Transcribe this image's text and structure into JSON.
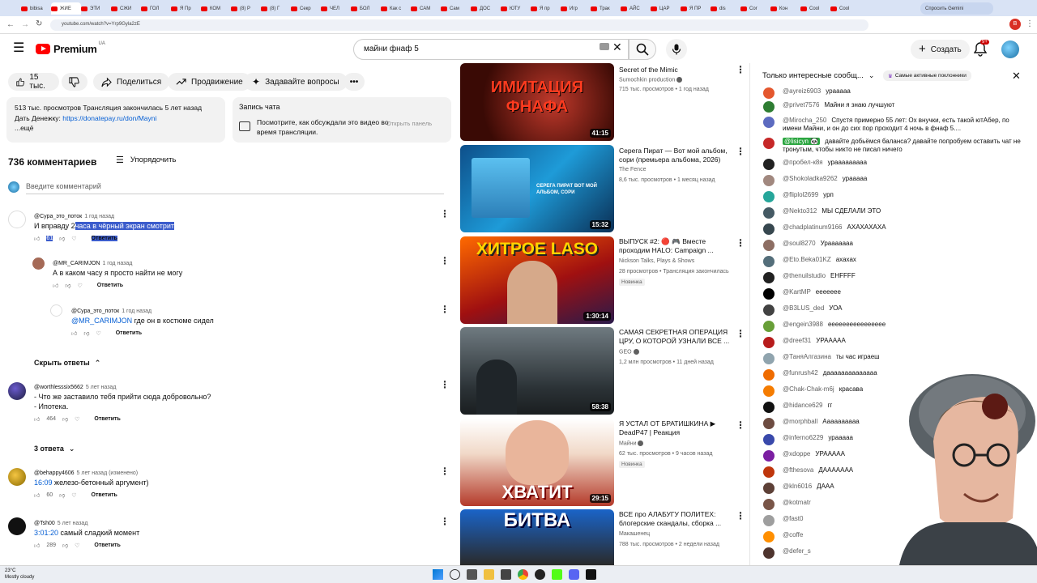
{
  "browser": {
    "tabs": [
      "bibisa",
      "ЖИЕ",
      "ЭТИ",
      "СЖИ",
      "ГОЛ",
      "Я Пр",
      "КОМ",
      "(8) Р",
      "(8) Г",
      "Секр",
      "ЧЕЛ",
      "БОЛ",
      "Как с",
      "САМ",
      "Сам",
      "ДОС",
      "ЮТУ",
      "Я пр",
      "Игр",
      "Трак",
      "АЙС",
      "ЦАР",
      "Я ПР",
      "dis",
      "Cor",
      "Кон",
      "Cool",
      "Cool"
    ],
    "gemini": "Спросить Gemini",
    "url": "youtube.com/watch?v=Yrp9Gyla2zE"
  },
  "header": {
    "logo": "Premium",
    "region": "UA",
    "search_value": "майни фнаф 5",
    "create": "Создать",
    "notif_count": "9+"
  },
  "video_actions": {
    "likes": "15 тыс.",
    "share": "Поделиться",
    "promote": "Продвижение",
    "ask": "Задавайте вопросы"
  },
  "description": {
    "meta": "513 тыс. просмотров  Трансляция закончилась 5 лет назад",
    "donate_label": "Дать Денежку:",
    "donate_link": "https://donatepay.ru/don/Mayni",
    "more": "...ещё"
  },
  "chat_replay": {
    "title": "Запись чата",
    "text": "Посмотрите, как обсуждали это видео во время трансляции.",
    "open": "Открыть панель"
  },
  "comments": {
    "count": "736 комментариев",
    "sort": "Упорядочить",
    "placeholder": "Введите комментарий",
    "reply_label": "Ответить",
    "hide_replies": "Скрыть ответы",
    "items": [
      {
        "author": "@Сура_это_поток",
        "time": "1 год назад",
        "text_plain": "И вправду 2",
        "text_hl": "часа в чёрный экран смотрит",
        "likes": "61"
      },
      {
        "author": "@MR_CARIMJON",
        "time": "1 год назад",
        "text": "А в каком часу я просто найти не могу"
      },
      {
        "author": "@Сура_это_поток",
        "time": "1 год назад",
        "mention": "@MR_CARIMJON",
        "text": "где он в костюме сидел"
      },
      {
        "author": "@worthlesssix5662",
        "time": "5 лет назад",
        "text": "- Что же заставило тебя прийти сюда добровольно?",
        "text2": "- Ипотека.",
        "likes": "464",
        "replies": "3 ответа"
      },
      {
        "author": "@behappy4606",
        "time": "5 лет назад (изменено)",
        "ts": "16:09",
        "text": "железо-бетонный аргумент)",
        "likes": "60"
      },
      {
        "author": "@Tsh00",
        "time": "5 лет назад",
        "ts": "3:01:20",
        "text": "самый сладкий момент",
        "likes": "289"
      }
    ]
  },
  "related": [
    {
      "title": "Secret of the Mimic",
      "channel": "Sumochkin production",
      "stats": "715 тыс. просмотров • 1 год назад",
      "duration": "41:15",
      "thumb_text": "ИМИТАЦИЯ ФНАФА"
    },
    {
      "title": "Серега Пират — Вот мой альбом, сори (премьера альбома, 2026)",
      "channel": "The Fence",
      "stats": "8,6 тыс. просмотров • 1 месяц назад",
      "duration": "15:32",
      "thumb_text": "СЕРЕГА ПИРАТ ВОТ МОЙ АЛЬБОМ, СОРИ"
    },
    {
      "title": "ВЫПУСК #2: 🔴 🎮 Вместе проходим HALO: Campaign ...",
      "channel": "Nickson Talks, Plays & Shows",
      "stats": "28 просмотров • Трансляция закончилась",
      "badge": "Новинка",
      "duration": "1:30:14",
      "thumb_text": "ХИТРОЕ LASO"
    },
    {
      "title": "САМАЯ СЕКРЕТНАЯ ОПЕРАЦИЯ ЦРУ, О КОТОРОЙ УЗНАЛИ ВСЕ ...",
      "channel": "GEO",
      "stats": "1,2 млн просмотров • 11 дней назад",
      "duration": "58:38",
      "thumb_text": ""
    },
    {
      "title": "Я УСТАЛ ОТ БРАТИШКИНА ▶ DeadP47 | Реакция",
      "channel": "Майни",
      "stats": "62 тыс. просмотров • 9 часов назад",
      "badge": "Новинка",
      "duration": "29:15",
      "thumb_text": "ХВАТИТ"
    },
    {
      "title": "ВСЕ про АЛАБУГУ ПОЛИТЕХ: блогерские скандалы, сборка ...",
      "channel": "Макашенец",
      "stats": "788 тыс. просмотров • 2 недели назад",
      "duration": "",
      "thumb_text": "БИТВА"
    }
  ],
  "chat": {
    "filter": "Только интересные сообщ...",
    "badge": "Самые активные поклонники",
    "messages": [
      {
        "a": "@ayreiz6903",
        "t": "урааааа",
        "c": "#e4572e"
      },
      {
        "a": "@privet7576",
        "t": "Майни я знаю лучшуют",
        "c": "#2e7d32"
      },
      {
        "a": "@Mirocha_250",
        "t": "Спустя примерно 55 лет: Ох внучки, есть такой ютАбер, по имени Майни, и он до сих пор проходит 4 ночь в фнаф 5....",
        "c": "#5c6bc0"
      },
      {
        "a": "@lisicyn 🐼",
        "t": "давайте добьёмся баланса? давайте попробуем оставить чат не тронутым, чтобы никто не писал ничего",
        "c": "#c62828",
        "hl": true
      },
      {
        "a": "@пробел-к8я",
        "t": "урааааааааа",
        "c": "#222222"
      },
      {
        "a": "@Shokoladka9262",
        "t": "урааааа",
        "c": "#a1887f"
      },
      {
        "a": "@fliplol2699",
        "t": "урп",
        "c": "#26a69a"
      },
      {
        "a": "@Nekto312",
        "t": "МЫ СДЕЛАЛИ ЭТО",
        "c": "#455a64"
      },
      {
        "a": "@chadplatinum9166",
        "t": "АХАХАХАХА",
        "c": "#37474f"
      },
      {
        "a": "@soul8270",
        "t": "Урааааааа",
        "c": "#8d6e63"
      },
      {
        "a": "@Eto.Beka01KZ",
        "t": "ахахах",
        "c": "#546e7a"
      },
      {
        "a": "@thenuilstudio",
        "t": "ЕНFFFF",
        "c": "#212121"
      },
      {
        "a": "@KartMP",
        "t": "еееееее",
        "c": "#000000"
      },
      {
        "a": "@B3LUS_ded",
        "t": "УОА",
        "c": "#424242"
      },
      {
        "a": "@engein3988",
        "t": "ееееееееееееееее",
        "c": "#689f38"
      },
      {
        "a": "@dreef31",
        "t": "УРААААА",
        "c": "#b71c1c"
      },
      {
        "a": "@ТаняАлгазина",
        "t": "ты час играеш",
        "c": "#90a4ae"
      },
      {
        "a": "@funrush42",
        "t": "даааааааааааааа",
        "c": "#ef6c00"
      },
      {
        "a": "@Chak-Chak-m6j",
        "t": "красава",
        "c": "#f57c00"
      },
      {
        "a": "@hidance629",
        "t": "гг",
        "c": "#111111"
      },
      {
        "a": "@morphball",
        "t": "Аааааааааа",
        "c": "#6d4c41"
      },
      {
        "a": "@inferno6229",
        "t": "урааааа",
        "c": "#3949ab"
      },
      {
        "a": "@xdoppe",
        "t": "УРААААА",
        "c": "#7b1fa2"
      },
      {
        "a": "@fthesova",
        "t": "ДААААААА",
        "c": "#bf360c"
      },
      {
        "a": "@kln6016",
        "t": "ДААА",
        "c": "#5d4037"
      },
      {
        "a": "@kotmatr",
        "t": "",
        "c": "#795548"
      },
      {
        "a": "@fast0",
        "t": "",
        "c": "#9e9e9e"
      },
      {
        "a": "@coffe",
        "t": "",
        "c": "#ff8f00"
      },
      {
        "a": "@defer_s",
        "t": "",
        "c": "#4e342e"
      }
    ]
  },
  "taskbar": {
    "temp": "23°C",
    "weather": "Mostly cloudy"
  }
}
